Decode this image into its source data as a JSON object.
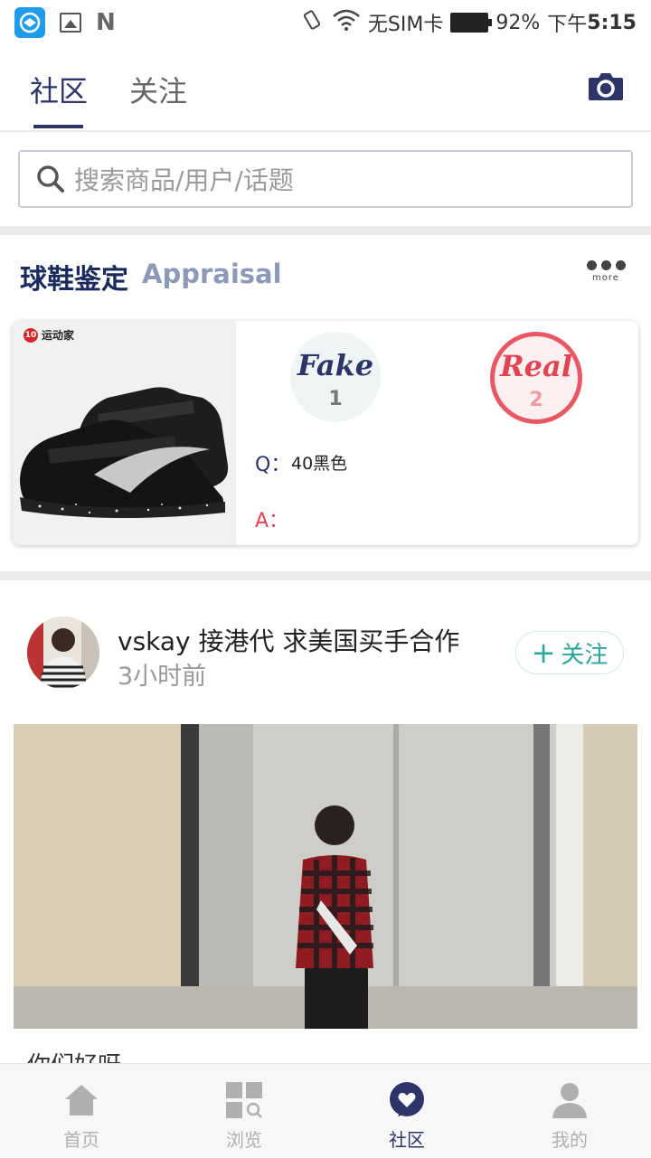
{
  "status_bar": {
    "carrier": "无SIM卡",
    "battery": "92%",
    "time_prefix": "下午",
    "time": "5:15"
  },
  "top_tabs": {
    "community": "社区",
    "follow": "关注"
  },
  "search": {
    "placeholder": "搜索商品/用户/话题"
  },
  "appraisal": {
    "title": "球鞋鉴定",
    "subtitle": "Appraisal",
    "more_label": "more",
    "brand": "运动家",
    "fake_label": "Fake",
    "fake_count": "1",
    "real_label": "Real",
    "real_count": "2",
    "q_label": "Q：",
    "question": "40黑色",
    "a_label": "A："
  },
  "post": {
    "username": "vskay 接港代 求美国买手合作",
    "time": "3小时前",
    "follow_label": "关注",
    "caption": "你们好呀"
  },
  "bottom_nav": [
    {
      "label": "首页",
      "icon": "home-icon"
    },
    {
      "label": "浏览",
      "icon": "browse-icon"
    },
    {
      "label": "社区",
      "icon": "community-icon"
    },
    {
      "label": "我的",
      "icon": "profile-icon"
    }
  ],
  "colors": {
    "brand": "#2d3568",
    "fake_bg": "#eef5f4",
    "real": "#e04452",
    "follow": "#2aa59a"
  }
}
